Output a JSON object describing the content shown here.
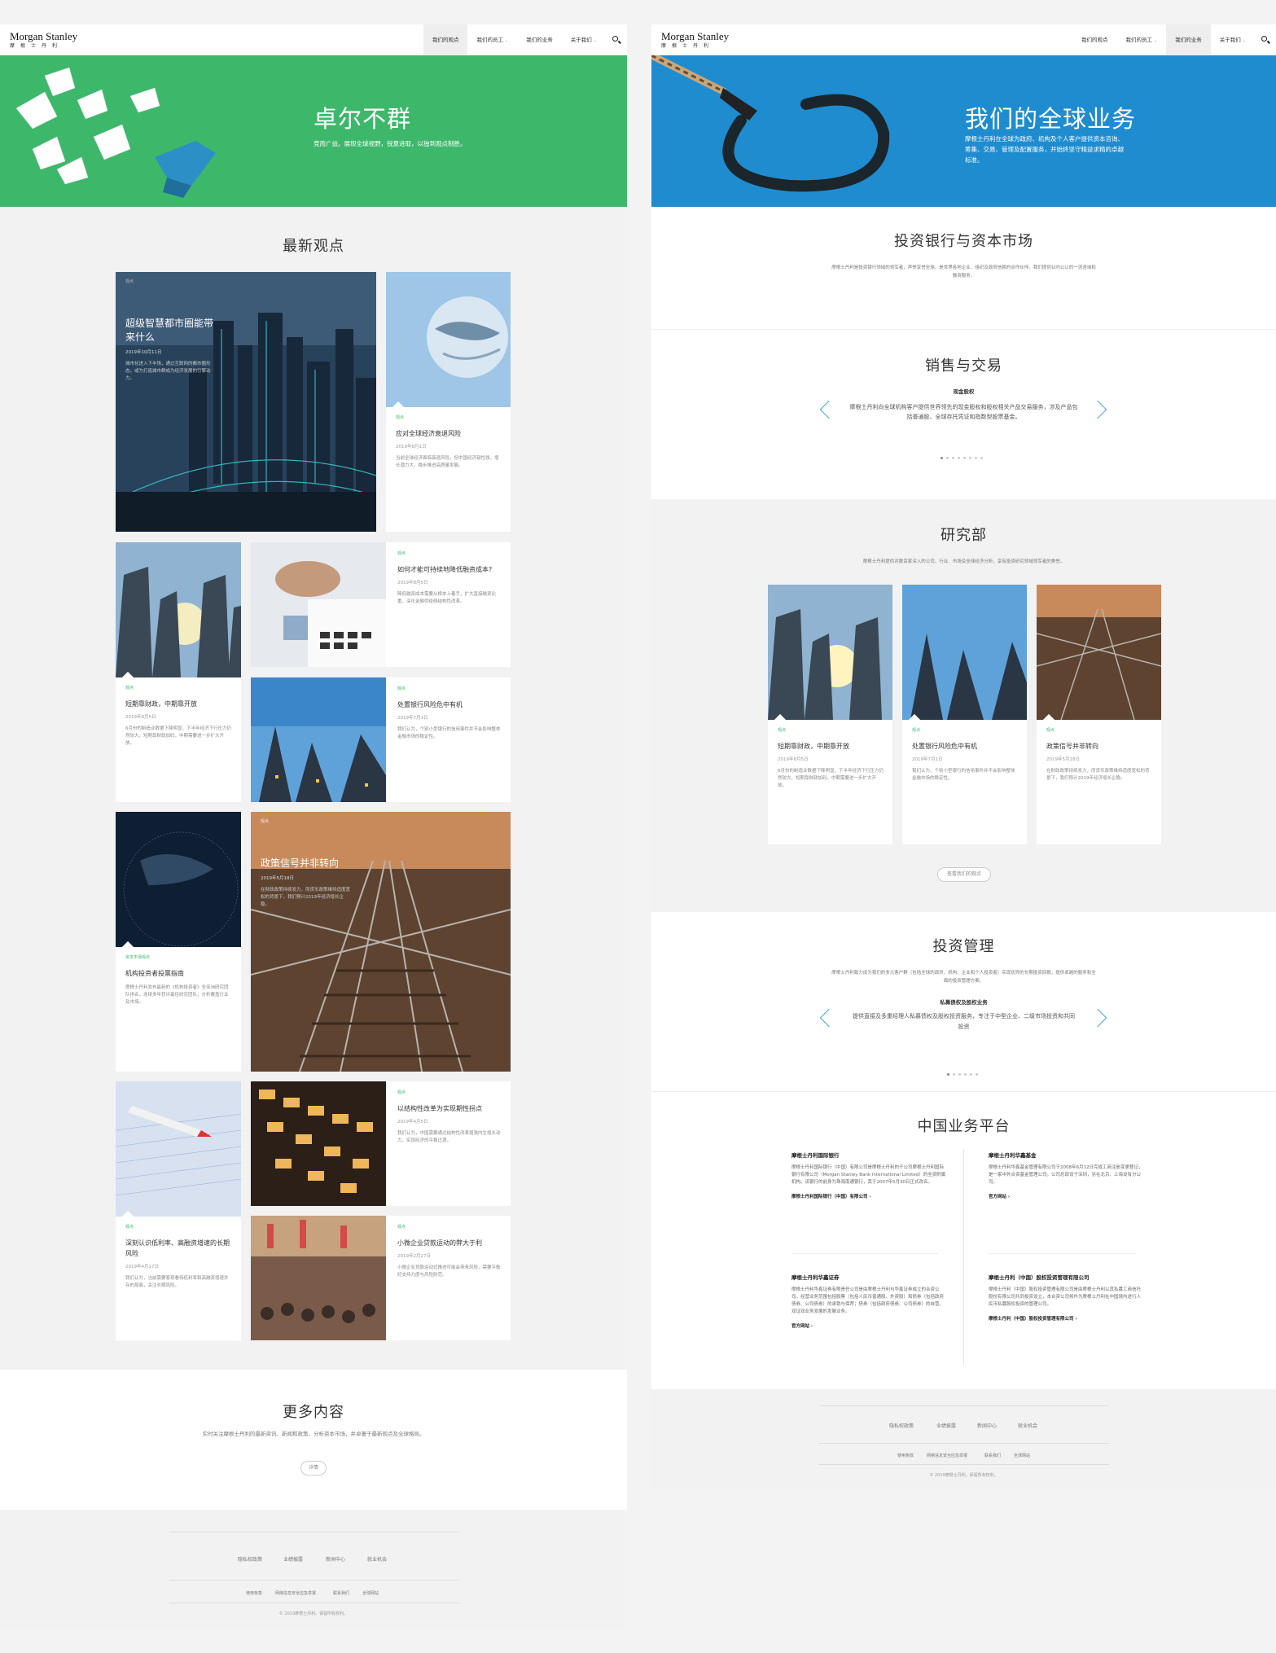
{
  "brand": {
    "name_en": "Morgan Stanley",
    "name_zh": "摩根士丹利"
  },
  "left": {
    "nav": [
      "我们的观点",
      "我们的员工",
      "我们的业务",
      "关于我们"
    ],
    "hero": {
      "title": "卓尔不群",
      "subtitle": "竞而广益。展现全球视野，锐意进取，以独到观点制胜。"
    },
    "section_title": "最新观点",
    "cards": [
      {
        "tag": "观点",
        "title": "超级智慧都市圈能带来什么",
        "date": "2019年10月11日",
        "text": "城市化进入下半场，通过互联网的都市圈形态，或为打造城市群成为经济发展的引擎动力。"
      },
      {
        "tag": "观点",
        "title": "应对全球经济衰退风险",
        "date": "2019年8月1日",
        "text": "当前全球经济面临衰退风险，但中国经济韧性强，增长潜力大，稳步推进高质量发展。"
      },
      {
        "tag": "观点",
        "title": "如何才能可持续地降低融资成本?",
        "date": "2019年8月5日",
        "text": "降低融资成本需要从根本上着手，扩大直接融资比重，深化金融供给侧结构性改革。"
      },
      {
        "tag": "观点",
        "title": "短期靠财政，中期靠开放",
        "date": "2019年8月5日",
        "text": "6月份的制造业数据下降明显，下半年经济下行压力仍然较大，短期靠财政加码，中期需要进一步扩大开放。"
      },
      {
        "tag": "观点",
        "title": "处置银行风险危中有机",
        "date": "2019年7月1日",
        "text": "我们认为，个别小型银行的信用事件并不会影响整体金融市场的稳定性。"
      },
      {
        "tag": "资本市场观点",
        "title": "机构投资者投票指南",
        "date": "",
        "text": "摩根士丹利发布最新的《机构投资者》全亚洲研究团队排名，连续多年获评最佳研究团队，分析覆盖行业及市场。"
      },
      {
        "tag": "观点",
        "title": "政策信号并非转向",
        "date": "2019年5月18日",
        "text": "在财政政策持续发力，而货币政策维持适度宽松的背景下，我们预计2019年经济增长企稳。"
      },
      {
        "tag": "观点",
        "title": "深刻认识低利率、高融资增速的长期风险",
        "date": "2019年4月17日",
        "text": "我们认为，当前需要客观看待低利率和高融资增速并存的局面，关注长期风险。"
      },
      {
        "tag": "观点",
        "title": "以结构性改革为实现期性拐点",
        "date": "2019年4月5日",
        "text": "我们认为，中国需要通过结构性改革增强内生增长动力，实现经济的平稳过渡。"
      },
      {
        "tag": "观点",
        "title": "小微企业贷款运动的弊大于利",
        "date": "2019年2月27日",
        "text": "小微企业贷款运动式推进可能会带来风险，需要平衡好支持力度与风险防范。"
      }
    ],
    "more": {
      "title": "更多内容",
      "text": "实时关注摩根士丹利的最新资讯、新闻和政策、分析资本市场，并卓著于最新观点及全球格局。",
      "button": "详情"
    },
    "footer": {
      "row1": [
        "隐私权政策",
        "业绩披露",
        "新闻中心",
        "就业机会"
      ],
      "row2": [
        "使用条款",
        "网络信息安全应急举报",
        "联系我们",
        "全球网站"
      ],
      "copyright": "© 2019摩根士丹利。保留所有权利。"
    }
  },
  "right": {
    "nav": [
      "我们的观点",
      "我们的员工",
      "我们的业务",
      "关于我们"
    ],
    "hero": {
      "title": "我们的全球业务",
      "subtitle": "摩根士丹利在全球为政府、机构及个人客户提供资本咨询、筹集、交易、管理及配置服务，并始终坚守精益求精的卓越标准。"
    },
    "ib": {
      "title": "投资银行与资本市场",
      "text": "摩根士丹利是投资银行领域的领军者，声誉享誉全球。是世界各地企业、组织及政府信赖的合作伙伴。我们提供业内公认的一流咨询和融资服务。"
    },
    "sales": {
      "title": "销售与交易",
      "sub": "现金股权",
      "text": "摩根士丹利向全球机构客户提供世界领先的现金股权和股权相关产品交易服务，涉及产品包括普通股、全球存托凭证和指数型股票基金。"
    },
    "research": {
      "title": "研究部",
      "text": "摩根士丹利提供对数百家深入的公司、行业、市场及全球经济分析，享有投资研究领域领军者的美誉。",
      "cards": [
        {
          "tag": "观点",
          "title": "短期靠财政，中期靠开放",
          "date": "2019年8月5日",
          "text": "6月份的制造业数据下降明显，下半年经济下行压力仍然较大，短期靠财政加码，中期需要进一步扩大开放。"
        },
        {
          "tag": "观点",
          "title": "处置银行风险危中有机",
          "date": "2019年7月1日",
          "text": "我们认为，个别小型银行的信用事件并不会影响整体金融市场的稳定性。"
        },
        {
          "tag": "观点",
          "title": "政策信号并非转向",
          "date": "2019年5月18日",
          "text": "在财政政策持续发力，而货币政策维持适度宽松的背景下，我们预计2019年经济增长企稳。"
        }
      ],
      "button": "查看我们的观点"
    },
    "im": {
      "title": "投资管理",
      "text": "摩根士丹利致力成为我们的多元客户群（包括全球的政府、机构、企业和个人投资者）实现优异的长期投资回报，提供卓越的服务和全面的投资管理方案。",
      "sub": "私募债权及股权业务",
      "text2": "提供直接及多重经理人私募债权及股权投资服务，专注于中型企业、二级市场投资和共同投资"
    },
    "china": {
      "title": "中国业务平台",
      "items": [
        {
          "title": "摩根士丹利国际银行",
          "text": "摩根士丹利国际银行（中国）有限公司是摩根士丹利的子公司摩根士丹利国际银行有限公司（Morgan Stanley Bank International Limited）的全资附属机构。该银行的前身为珠海南通银行，其于2007年5月30日正式改名。",
          "link": "摩根士丹利国际银行（中国）有限公司 ›"
        },
        {
          "title": "摩根士丹利华鑫基金",
          "text": "摩根士丹利华鑫基金管理有限公司于2008年6月12日完成工商注册变更登记，是一家中外合资基金管理公司。公司总部设于深圳，另在北京、上海设有分公司。",
          "link": "官方网站 ›"
        },
        {
          "title": "摩根士丹利华鑫证券",
          "text": "摩根士丹利华鑫证券有限责任公司是由摩根士丹利与华鑫证券成立的合资公司。经营业务范围包括股票（包括人民币普通股、外资股）和债券（包括政府债券、公司债券）的承销与保荐；债券（包括政府债券、公司债券）的自营。双证双业务发展的发展业务。",
          "link": "官方网站 ›"
        },
        {
          "title": "摩根士丹利（中国）股权投资管理有限公司",
          "text": "摩根士丹利（中国）股权投资管理有限公司是由摩根士丹利以其私募工商信托股份有限公司共同投资设立，本合资公司将作为摩根士丹利在中国境内进行人民币私募股权投资的管理公司。",
          "link": "摩根士丹利（中国）股权投资管理有限公司 ›"
        }
      ]
    },
    "footer": {
      "row1": [
        "隐私权政策",
        "业绩披露",
        "新闻中心",
        "就业机会"
      ],
      "row2": [
        "使用条款",
        "网络信息安全应急举报",
        "联系我们",
        "全球网站"
      ],
      "copyright": "© 2019摩根士丹利。保留所有权利。"
    }
  }
}
